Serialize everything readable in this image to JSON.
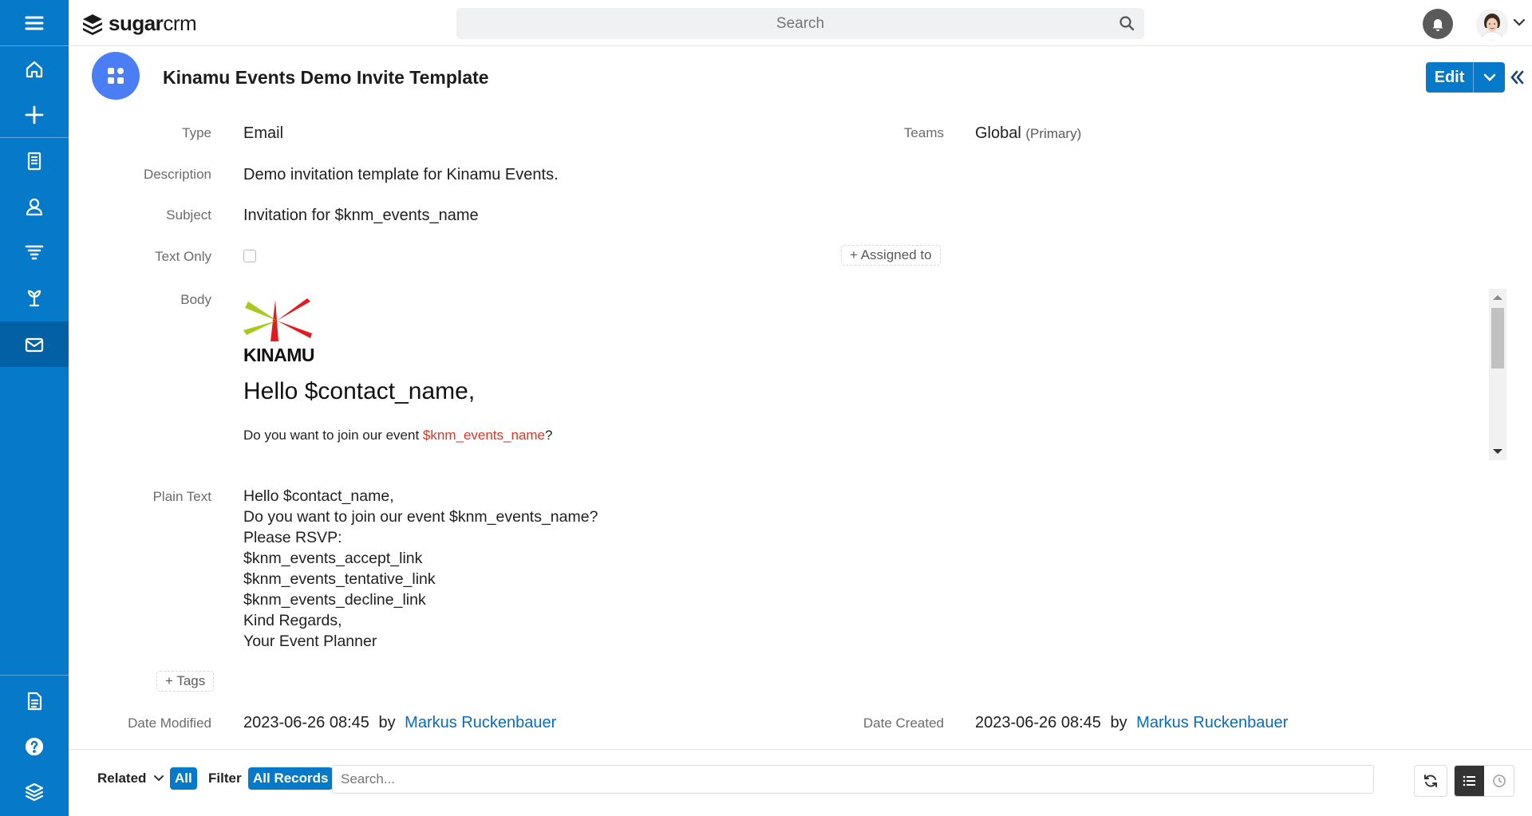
{
  "sidebar": {
    "items": [
      {
        "icon": "menu-icon"
      },
      {
        "icon": "home-icon"
      },
      {
        "icon": "plus-icon"
      },
      {
        "icon": "accounts-icon"
      },
      {
        "icon": "contacts-icon"
      },
      {
        "icon": "leads-icon"
      },
      {
        "icon": "opportunities-icon"
      },
      {
        "icon": "email-icon",
        "active": true
      },
      {
        "icon": "documents-icon"
      },
      {
        "icon": "help-icon"
      },
      {
        "icon": "layers-icon"
      }
    ]
  },
  "header": {
    "logo_bold": "sugar",
    "logo_light": "crm",
    "search_placeholder": "Search"
  },
  "record": {
    "title": "Kinamu Events Demo Invite Template",
    "edit_label": "Edit"
  },
  "fields": {
    "type_label": "Type",
    "type_value": "Email",
    "teams_label": "Teams",
    "teams_value": "Global",
    "teams_primary": "(Primary)",
    "description_label": "Description",
    "description_value": "Demo invitation template for Kinamu Events.",
    "subject_label": "Subject",
    "subject_value": "Invitation for $knm_events_name",
    "text_only_label": "Text Only",
    "text_only_checked": false,
    "assigned_to_label": "+ Assigned to",
    "body_label": "Body",
    "plain_text_label": "Plain Text",
    "tags_label": "+ Tags",
    "date_modified_label": "Date Modified",
    "date_modified_value": "2023-06-26 08:45",
    "date_modified_by": "by",
    "date_modified_user": "Markus Ruckenbauer",
    "date_created_label": "Date Created",
    "date_created_value": "2023-06-26 08:45",
    "date_created_by": "by",
    "date_created_user": "Markus Ruckenbauer"
  },
  "body_preview": {
    "logo_text": "KINAMU",
    "greeting": "Hello $contact_name,",
    "question_prefix": "Do you want to join our event ",
    "question_variable": "$knm_events_name",
    "question_suffix": "?",
    "accent_color": "#d23a2a"
  },
  "plain_text": {
    "lines": [
      "Hello $contact_name,",
      "Do you want to join our event $knm_events_name?",
      "Please RSVP:",
      "$knm_events_accept_link",
      "$knm_events_tentative_link",
      "$knm_events_decline_link",
      "Kind Regards,",
      "Your Event Planner"
    ]
  },
  "subpanel": {
    "related_label": "Related",
    "all_label": "All",
    "filter_label": "Filter",
    "all_records_label": "All Records",
    "search_placeholder": "Search..."
  },
  "colors": {
    "brand": "#0679c8",
    "sidebar_active": "#0360a5",
    "module_badge": "#4b7df5",
    "link": "#0a6cc0"
  }
}
